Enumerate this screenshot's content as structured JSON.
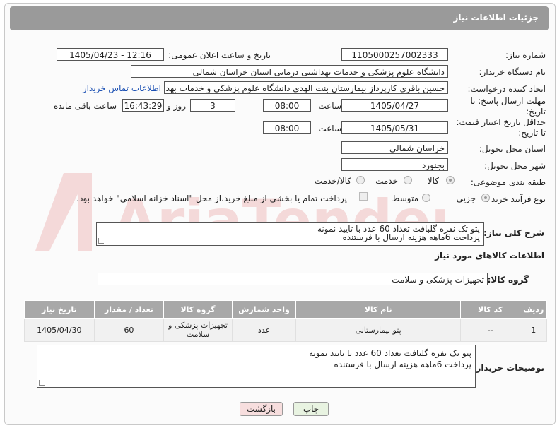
{
  "header": {
    "title": "جزئیات اطلاعات نیاز"
  },
  "form": {
    "need_number_label": "شماره نیاز:",
    "need_number": "1105000257002333",
    "announce_label": "تاریخ و ساعت اعلان عمومی:",
    "announce_value": "1405/04/23 - 12:16",
    "buyer_org_label": "نام دستگاه خریدار:",
    "buyer_org": "دانشگاه علوم پزشکی و خدمات بهداشتی درمانی استان خراسان شمالی",
    "creator_label": "ایجاد کننده درخواست:",
    "creator": "حسین باقری کارپرداز بیمارستان بنت الهدی دانشگاه علوم پزشکی و خدمات بهد",
    "contact_link": "اطلاعات تماس خریدار",
    "reply_deadline_label": "مهلت ارسال پاسخ: تا تاریخ:",
    "reply_date": "1405/04/27",
    "time_label": "ساعت",
    "reply_time": "08:00",
    "days_value": "3",
    "days_label": "روز و",
    "remaining_time": "16:43:29",
    "remaining_label": "ساعت باقی مانده",
    "price_deadline_label": "حداقل تاریخ اعتبار قیمت: تا تاریخ:",
    "price_date": "1405/05/31",
    "price_time": "08:00",
    "province_label": "استان محل تحویل:",
    "province": "خراسان شمالی",
    "city_label": "شهر محل تحویل:",
    "city": "بجنورد",
    "category_label": "طبقه بندی موضوعی:",
    "category_options": [
      "کالا",
      "خدمت",
      "کالا/خدمت"
    ],
    "process_label": "نوع فرآیند خرید :",
    "process_options": [
      "جزیی",
      "متوسط"
    ],
    "payment_note": "پرداخت تمام یا بخشی از مبلغ خرید،از محل \"اسناد خزانه اسلامی\" خواهد بود."
  },
  "summary": {
    "label": "شرح کلی نیاز:",
    "line1": "پتو تک نفره گلبافت تعداد 60 عدد با تایید نمونه",
    "line2": "پرداخت 6ماهه هزینه ارسال با فرستنده"
  },
  "goods": {
    "section_title": "اطلاعات کالاهای مورد نیاز",
    "group_label": "گروه کالا:",
    "group_value": "تجهیزات پزشکی و سلامت",
    "columns": [
      "ردیف",
      "کد کالا",
      "نام کالا",
      "واحد شمارش",
      "گروه کالا",
      "تعداد / مقدار",
      "تاریخ نیاز"
    ],
    "rows": [
      {
        "row": "1",
        "code": "--",
        "name": "پتو بیمارستانی",
        "unit": "عدد",
        "group": "تجهیزات پزشکی و سلامت",
        "qty": "60",
        "date": "1405/04/30"
      }
    ]
  },
  "buyer_notes": {
    "label": "توضیحات خریدار:",
    "line1": "پتو تک نفره گلبافت تعداد 60 عدد با تایید نمونه",
    "line2": "پرداخت 6ماهه هزینه ارسال با فرستنده"
  },
  "buttons": {
    "print": "چاپ",
    "back": "بازگشت"
  },
  "colors": {
    "header": "#9a9a9a",
    "table_header": "#a8a8a8",
    "link": "#1a4fb3",
    "back_button": "#f7dede",
    "print_button": "#e8f3e1"
  }
}
